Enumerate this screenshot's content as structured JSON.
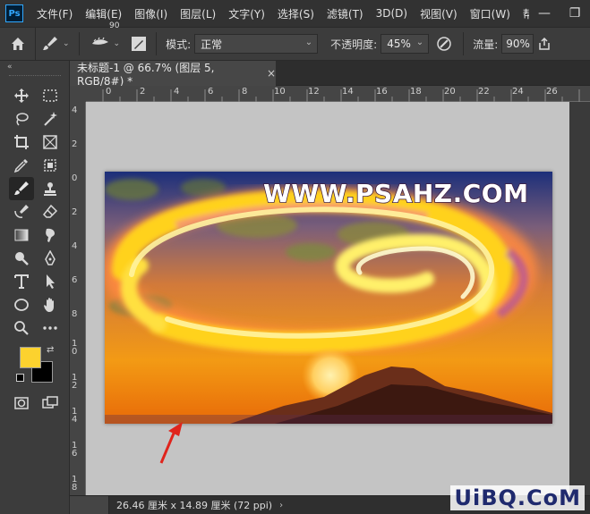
{
  "app": {
    "logo_text": "Ps"
  },
  "menu": [
    "文件(F)",
    "编辑(E)",
    "图像(I)",
    "图层(L)",
    "文字(Y)",
    "选择(S)",
    "滤镜(T)",
    "3D(D)",
    "视图(V)",
    "窗口(W)",
    "帮"
  ],
  "window_controls": {
    "minimize": "—",
    "restore": "❐"
  },
  "options_bar": {
    "brush_size": "90",
    "mode_label": "模式:",
    "mode_value": "正常",
    "opacity_label": "不透明度:",
    "opacity_value": "45%",
    "flow_label": "流量:",
    "flow_value": "90%"
  },
  "document_tab": {
    "title": "未标题-1 @ 66.7% (图层 5, RGB/8#) *",
    "close": "×"
  },
  "ruler": {
    "horizontal_ticks": [
      "0",
      "2",
      "4",
      "6",
      "8",
      "10",
      "12",
      "14",
      "16",
      "18",
      "20",
      "22",
      "24",
      "26"
    ],
    "vertical_ticks": [
      "4",
      "2",
      "0",
      "2",
      "4",
      "6",
      "8",
      "1\n0",
      "1\n2",
      "1\n4",
      "1\n6",
      "1\n8"
    ]
  },
  "artwork": {
    "watermark": "WWW.PSAHZ.COM"
  },
  "colors": {
    "foreground": "#fcd22e",
    "background": "#000000",
    "accent": "#31a8ff"
  },
  "status_bar": {
    "doc_size": "26.46 厘米 x 14.89 厘米 (72 ppi)",
    "chevron": "›"
  },
  "site_logo": "UiBQ.CoM",
  "icons": [
    "home-icon",
    "brush-icon",
    "brush-preset-icon",
    "toggle-brush-panel-icon",
    "airbrush-icon",
    "share-icon",
    "move-icon",
    "marquee-icon",
    "lasso-icon",
    "magic-wand-icon",
    "crop-icon",
    "frame-icon",
    "eyedropper-icon",
    "patch-icon",
    "brush-icon",
    "stamp-icon",
    "history-brush-icon",
    "eraser-icon",
    "gradient-icon",
    "smudge-icon",
    "dodge-icon",
    "pen-icon",
    "type-icon",
    "path-select-icon",
    "ellipse-icon",
    "hand-icon",
    "zoom-icon",
    "more-icon",
    "quick-mask-icon",
    "screen-mode-icon"
  ]
}
